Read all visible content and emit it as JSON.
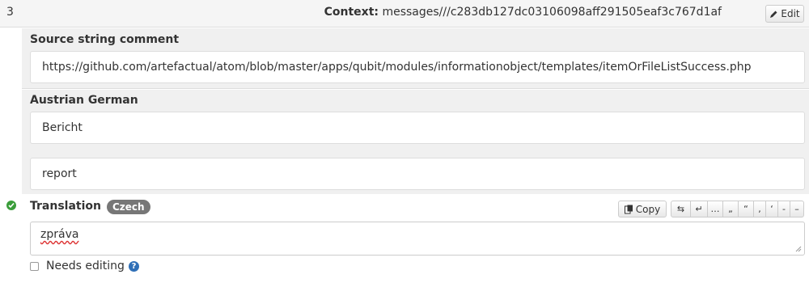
{
  "row": {
    "number": "3",
    "context_label": "Context:",
    "context_value": "messages///c283db127dc03106098aff291505eaf3c767d1af",
    "edit_label": "Edit"
  },
  "source": {
    "title": "Source string comment",
    "value": "https://github.com/artefactual/atom/blob/master/apps/qubit/modules/informationobject/templates/itemOrFileListSuccess.php"
  },
  "secondary": {
    "title": "Austrian German",
    "value_1": "Bericht",
    "value_2": "report"
  },
  "translation": {
    "title": "Translation",
    "language": "Czech",
    "copy_label": "Copy",
    "value": "zpráva",
    "needs_editing_label": "Needs editing"
  },
  "special_chars": [
    "⇆",
    "↵",
    "…",
    "„",
    "“",
    ",",
    "‘",
    "-",
    "–"
  ],
  "colors": {
    "ok": "#3a9d3a",
    "badge": "#777777",
    "help": "#2f6fb7"
  }
}
